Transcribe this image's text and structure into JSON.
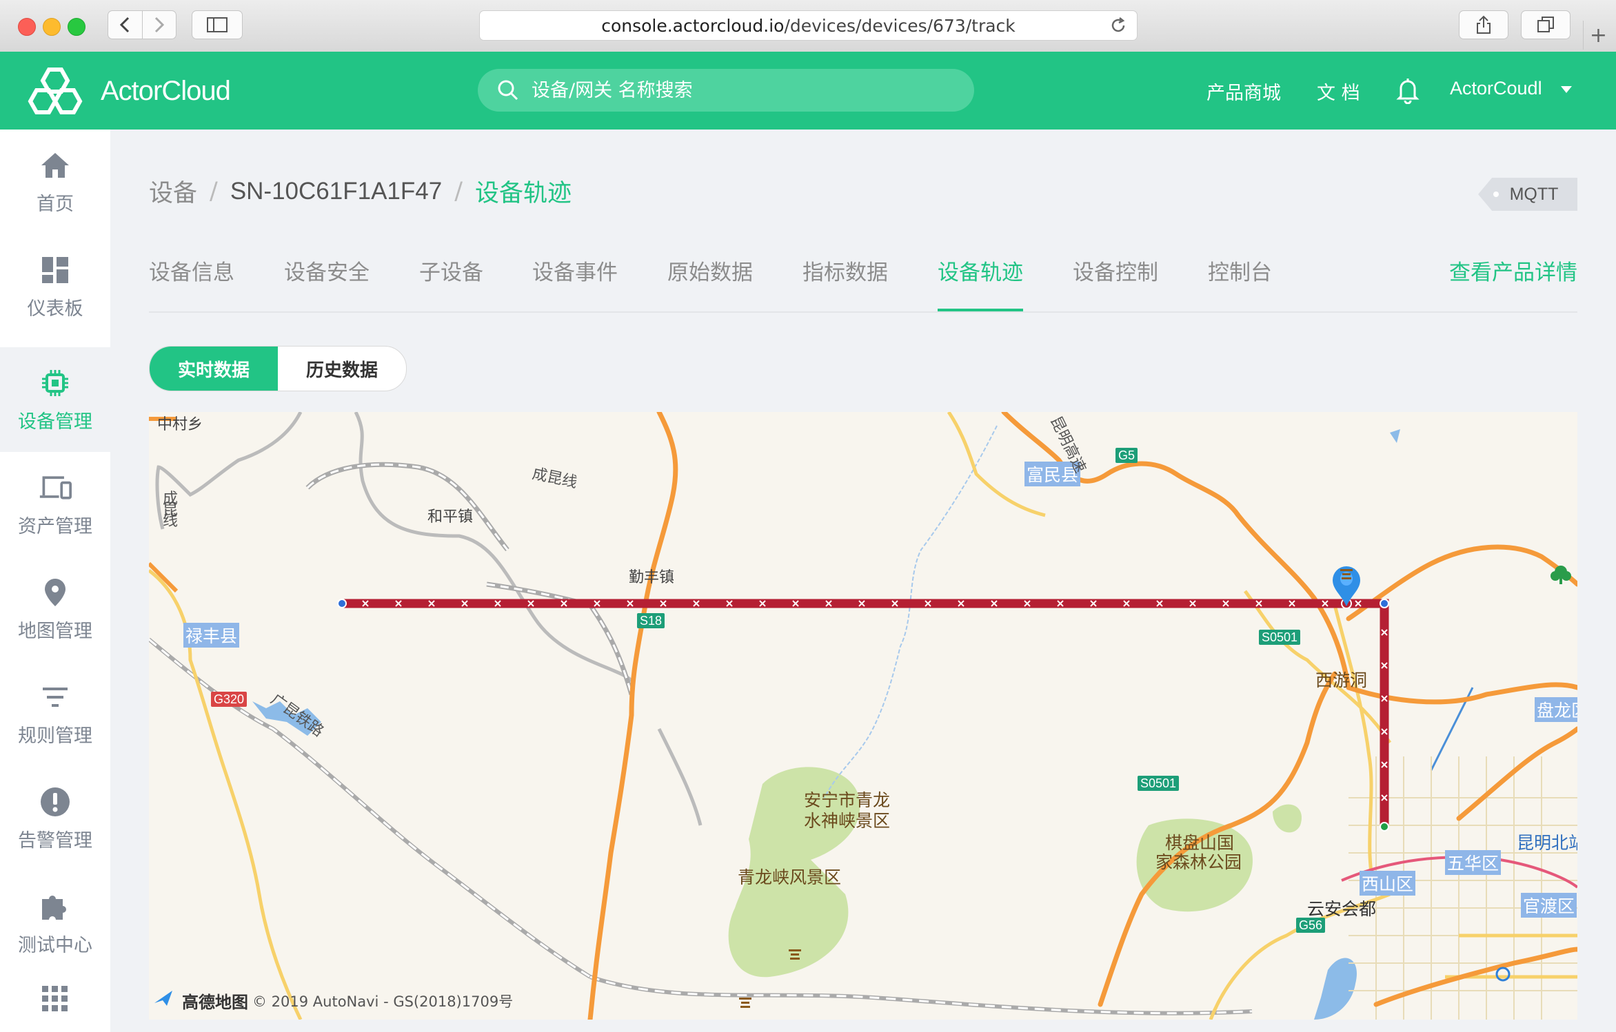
{
  "browser": {
    "url_host": "console.actorcloud.io",
    "url_path": "/devices/devices/673/track"
  },
  "header": {
    "brand": "ActorCloud",
    "search_placeholder": "设备/网关 名称搜索",
    "links": [
      "产品商城",
      "文 档"
    ],
    "user": "ActorCoudl"
  },
  "sidebar": {
    "items": [
      {
        "label": "首页",
        "icon": "home-icon"
      },
      {
        "label": "仪表板",
        "icon": "dashboard-icon"
      },
      {
        "label": "设备管理",
        "icon": "chip-icon",
        "active": true
      },
      {
        "label": "资产管理",
        "icon": "devices-icon"
      },
      {
        "label": "地图管理",
        "icon": "map-pin-icon"
      },
      {
        "label": "规则管理",
        "icon": "filter-icon"
      },
      {
        "label": "告警管理",
        "icon": "alert-icon"
      },
      {
        "label": "测试中心",
        "icon": "puzzle-icon"
      },
      {
        "label": "",
        "icon": "apps-grid-icon"
      }
    ]
  },
  "breadcrumb": [
    "设备",
    "SN-10C61F1A1F47",
    "设备轨迹"
  ],
  "protocol_tag": "MQTT",
  "tabs": [
    {
      "label": "设备信息"
    },
    {
      "label": "设备安全"
    },
    {
      "label": "子设备"
    },
    {
      "label": "设备事件"
    },
    {
      "label": "原始数据"
    },
    {
      "label": "指标数据"
    },
    {
      "label": "设备轨迹",
      "active": true
    },
    {
      "label": "设备控制"
    },
    {
      "label": "控制台"
    }
  ],
  "view_product_link": "查看产品详情",
  "data_mode": {
    "options": [
      "实时数据",
      "历史数据"
    ],
    "selected": "实时数据"
  },
  "map": {
    "places": [
      "中村乡",
      "和平镇",
      "勤丰镇",
      "富民县",
      "禄丰县",
      "西游洞",
      "安宁市青龙",
      "水神峡景区",
      "青龙峡风景区",
      "棋盘山国",
      "家森林公园",
      "西山区",
      "五华区",
      "盘龙区",
      "昆明北站",
      "官渡区",
      "云安会都"
    ],
    "roads": [
      "成昆线",
      "成",
      "昆",
      "线",
      "广昆铁路",
      "昆明高速"
    ],
    "shields": [
      "G5",
      "S18",
      "G320",
      "S0501",
      "S0501",
      "G56"
    ],
    "attribution_brand": "高德地图",
    "attribution": "© 2019 AutoNavi - GS(2018)1709号",
    "colors": {
      "track": "#b51f33",
      "highway": "#f59a3a",
      "park": "#cde3a8",
      "water": "#8cbbe8"
    }
  }
}
